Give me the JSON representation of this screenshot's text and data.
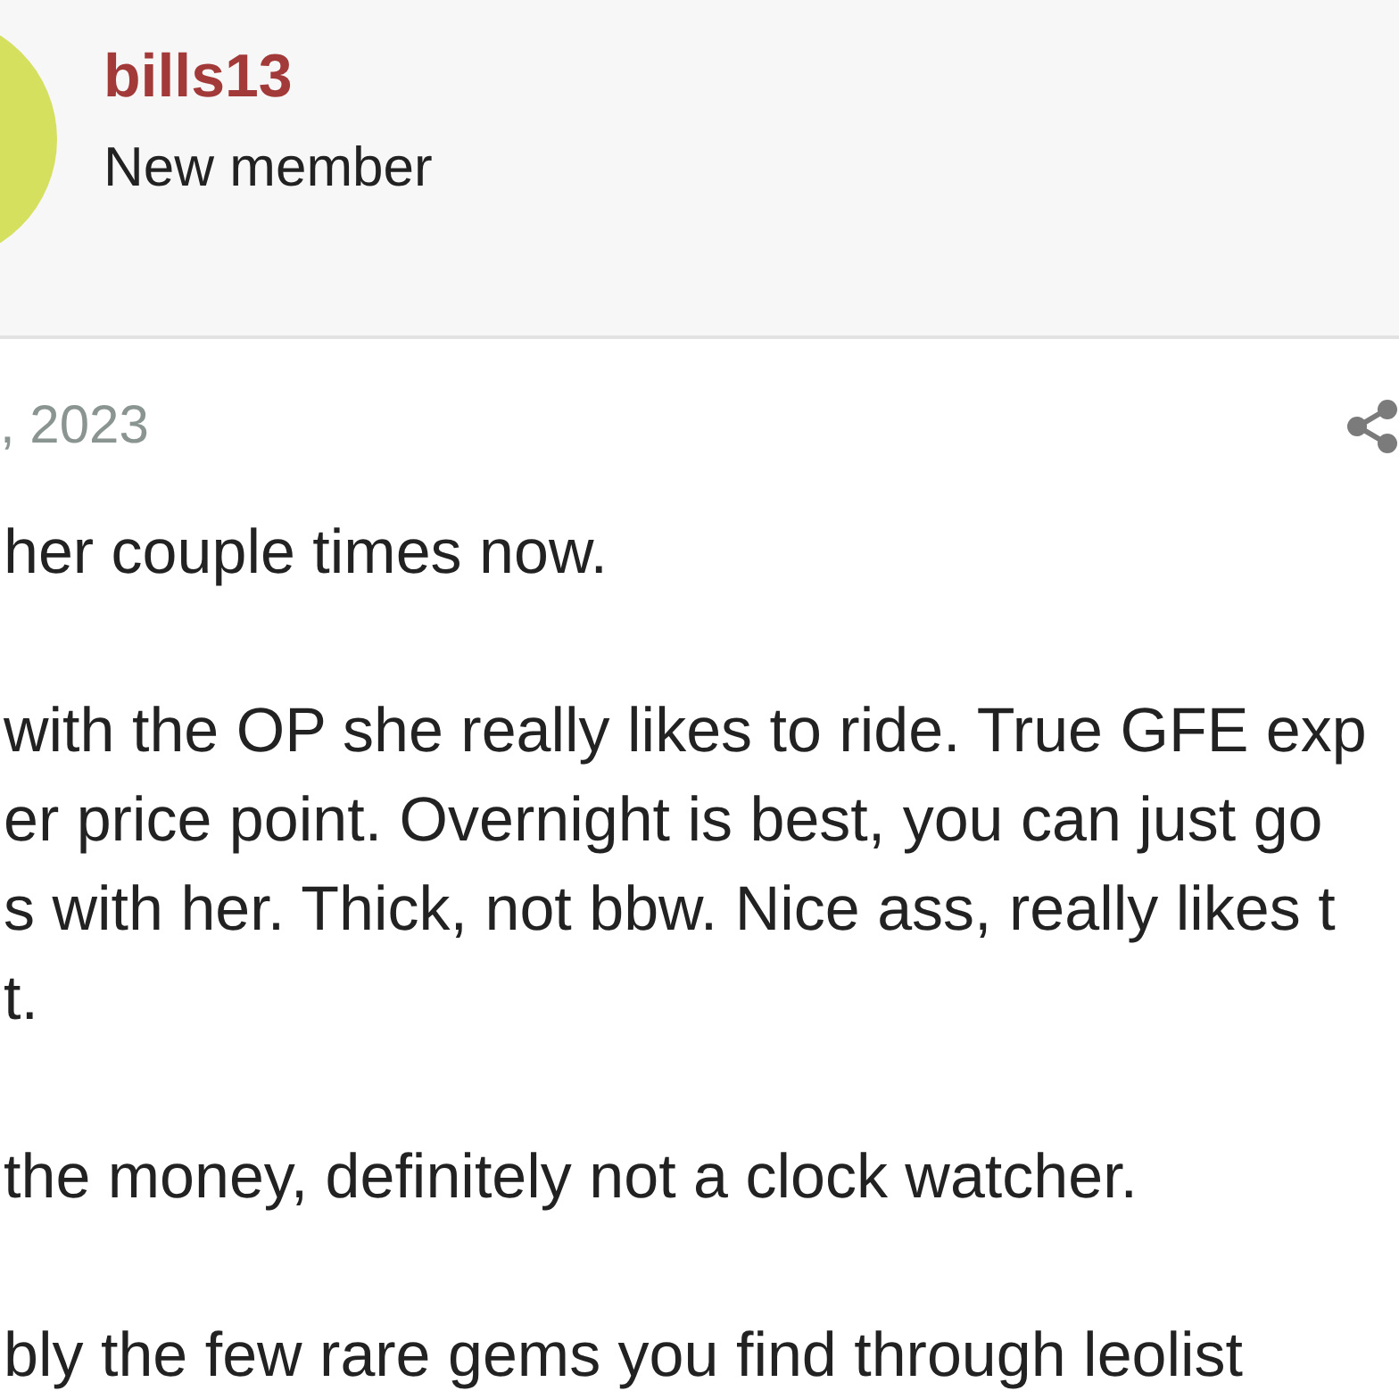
{
  "poster": {
    "username": "bills13",
    "role": "New member"
  },
  "post": {
    "date": ", 2023",
    "paragraphs": [
      {
        "lines": [
          "her couple times now."
        ]
      },
      {
        "lines": [
          "with the OP she really likes to ride. True GFE exp",
          "er price point. Overnight is best, you can just go",
          "s with her. Thick, not bbw. Nice ass, really likes t",
          "t."
        ]
      },
      {
        "lines": [
          "the money, definitely not a clock watcher."
        ]
      },
      {
        "lines": [
          "bly the few rare gems you find through leolist"
        ]
      }
    ]
  }
}
